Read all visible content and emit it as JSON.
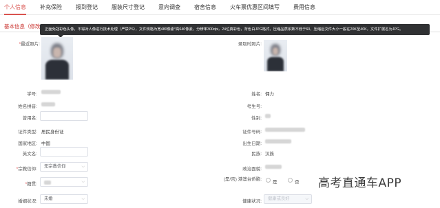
{
  "tabs": [
    {
      "label": "个人信息"
    },
    {
      "label": "补充保险"
    },
    {
      "label": "报到登记"
    },
    {
      "label": "服装尺寸登记"
    },
    {
      "label": "意向调查"
    },
    {
      "label": "宿舍信息"
    },
    {
      "label": "火车票优惠区间填写"
    },
    {
      "label": "费用信息"
    }
  ],
  "section": {
    "title": "基本信息（修改"
  },
  "tooltip": {
    "text": "正面免冠彩色头像，不得对人像进行技术处理（严禁PS），文件规格为宽480像素*高640像素，分辨率300dpi，24位真彩色，背色白JPG格式，压缩品质系数不低于60，压缩后文件大小一般在20K至40K，文件扩展名为JPG。"
  },
  "photos": {
    "recent_label": "最近照片:",
    "admission_label": "录取时照片:"
  },
  "left_fields": {
    "student_id_label": "学号:",
    "pinyin_label": "姓名拼音:",
    "former_name_label": "曾用名:",
    "id_type_label": "证件类型:",
    "id_type_value": "居民身份证",
    "region_label": "国家地区:",
    "region_value": "中国",
    "english_name_label": "英文名:",
    "religion_label": "宗教信仰:",
    "religion_value": "无宗教信仰",
    "origin_label": "籍贯:",
    "marital_label": "婚姻状况:",
    "marital_value": "未婚"
  },
  "right_fields": {
    "name_label": "姓名:",
    "name_value": "佣力",
    "exam_no_label": "考生号:",
    "gender_label": "性别:",
    "id_no_label": "证件号码:",
    "birth_label": "出生日期:",
    "ethnic_label": "民族:",
    "ethnic_value": "汉族",
    "political_label": "政治面貌:",
    "hkmt_label": "(是/否) 港澳台侨胞:",
    "yes_label": "是",
    "no_label": "否",
    "health_label": "健康状况:",
    "health_value": "健康或良好"
  },
  "watermark": {
    "text": "高考直通车APP"
  },
  "colors": {
    "accent": "#d9534f",
    "tooltip_bg": "#303133"
  }
}
